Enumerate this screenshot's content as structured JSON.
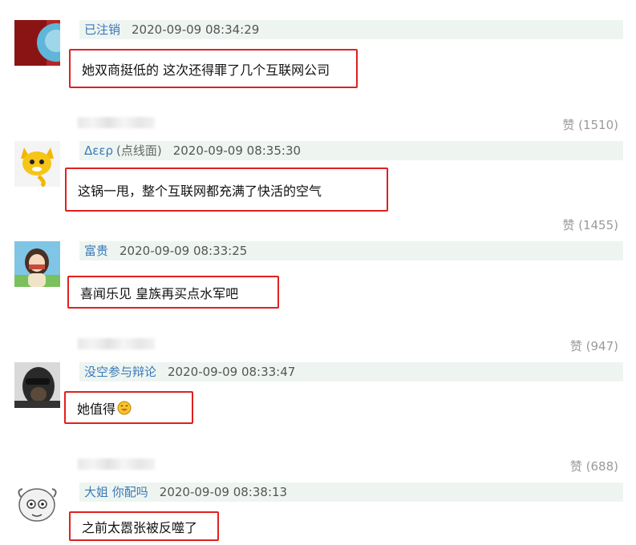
{
  "comments": [
    {
      "user": "已注销",
      "alias": "",
      "time": "2020-09-09 08:34:29",
      "text": "她双商挺低的 这次还得罪了几个互联网公司",
      "likes": "赞 (1510)"
    },
    {
      "user": "Δεερ",
      "alias": "(点线面)",
      "time": "2020-09-09 08:35:30",
      "text": "这锅一甩，整个互联网都充满了快活的空气",
      "likes": "赞 (1455)"
    },
    {
      "user": "富贵",
      "alias": "",
      "time": "2020-09-09 08:33:25",
      "text": "喜闻乐见 皇族再买点水军吧",
      "likes": "赞 (947)"
    },
    {
      "user": "没空参与辩论",
      "alias": "",
      "time": "2020-09-09 08:33:47",
      "text": "她值得",
      "likes": "赞 (688)"
    },
    {
      "user": "大姐 你配吗",
      "alias": "",
      "time": "2020-09-09 08:38:13",
      "text": "之前太嚣张被反噬了",
      "likes": ""
    }
  ],
  "colors": {
    "highlight_border": "#e02020",
    "meta_bg": "#eef5f1",
    "username": "#3a78b8"
  },
  "icons": [
    "avatar-photo-icon",
    "avatar-fox-icon",
    "avatar-girl-icon",
    "avatar-sunglasses-icon",
    "avatar-sheep-icon",
    "smile-emoji-icon"
  ]
}
